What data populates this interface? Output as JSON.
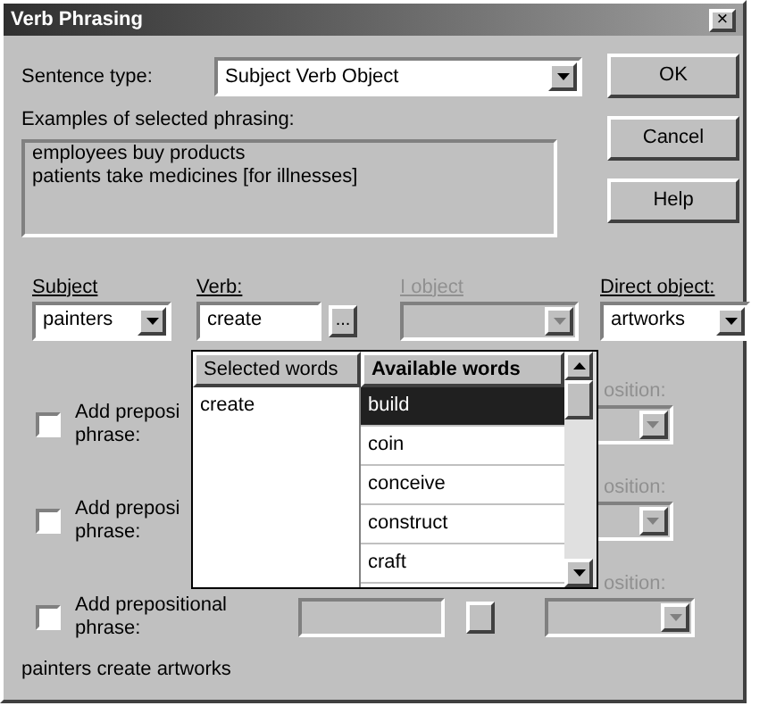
{
  "window": {
    "title": "Verb Phrasing",
    "close": "×"
  },
  "sentence_type": {
    "label": "Sentence type:",
    "value": "Subject Verb Object"
  },
  "buttons": [
    "OK",
    "Cancel",
    "Help"
  ],
  "examples": {
    "label": "Examples of selected phrasing:",
    "lines": [
      "employees buy products",
      "patients take medicines [for illnesses]"
    ]
  },
  "fields": [
    {
      "label": "Subject",
      "kind": "select",
      "value": "painters",
      "disabled": false
    },
    {
      "label": "Verb:",
      "kind": "text",
      "value": "create",
      "disabled": false,
      "button": "..."
    },
    {
      "label": "I object",
      "kind": "select",
      "disabled": true
    },
    {
      "label": "Direct object:",
      "kind": "select",
      "value": "artworks",
      "disabled": false
    }
  ],
  "word_popup": {
    "columns": [
      "Selected words",
      "Available words"
    ],
    "selected_words": [
      "create"
    ],
    "available_words": [
      {
        "text": "build",
        "selected": true
      },
      {
        "text": "coin",
        "selected": false
      },
      {
        "text": "conceive",
        "selected": false
      },
      {
        "text": "construct",
        "selected": false
      },
      {
        "text": "craft",
        "selected": false
      }
    ]
  },
  "prepositional_rows": [
    {
      "checked": false,
      "label_lines": [
        "Add preposi",
        "phrase:"
      ],
      "select_label": "osition:",
      "select_disabled": true
    },
    {
      "checked": false,
      "label_lines": [
        "Add preposi",
        "phrase:"
      ],
      "select_label": "osition:",
      "select_disabled": true
    },
    {
      "checked": false,
      "label_lines": [
        "Add prepositional",
        "phrase:"
      ],
      "select_label": "osition:",
      "select_disabled": true,
      "phrase_field": {
        "disabled": true
      }
    }
  ],
  "status": "painters create artworks"
}
